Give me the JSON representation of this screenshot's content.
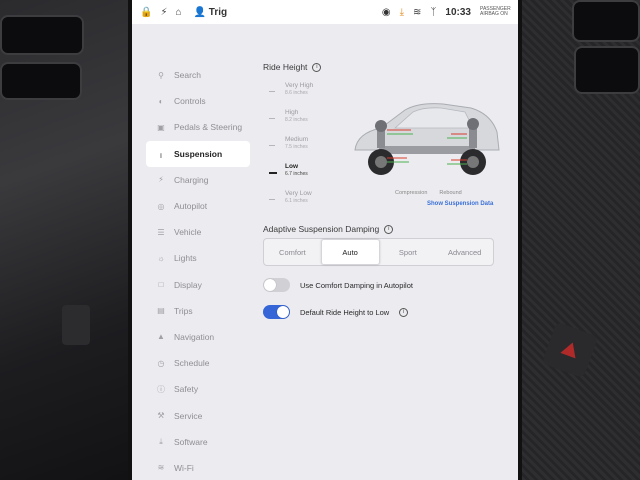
{
  "statusbar": {
    "user": "Trig",
    "time": "10:33",
    "airbag_label": "PASSENGER AIRBAG ON"
  },
  "sidebar": {
    "items": [
      {
        "label": "Search",
        "icon": "search-icon"
      },
      {
        "label": "Controls",
        "icon": "toggle-icon"
      },
      {
        "label": "Pedals & Steering",
        "icon": "car-icon"
      },
      {
        "label": "Suspension",
        "icon": "suspension-icon"
      },
      {
        "label": "Charging",
        "icon": "lightning-icon"
      },
      {
        "label": "Autopilot",
        "icon": "steering-wheel-icon"
      },
      {
        "label": "Vehicle",
        "icon": "sliders-icon"
      },
      {
        "label": "Lights",
        "icon": "bulb-icon"
      },
      {
        "label": "Display",
        "icon": "display-icon"
      },
      {
        "label": "Trips",
        "icon": "trips-icon"
      },
      {
        "label": "Navigation",
        "icon": "navigation-icon"
      },
      {
        "label": "Schedule",
        "icon": "clock-icon"
      },
      {
        "label": "Safety",
        "icon": "safety-icon"
      },
      {
        "label": "Service",
        "icon": "wrench-icon"
      },
      {
        "label": "Software",
        "icon": "download-icon"
      },
      {
        "label": "Wi-Fi",
        "icon": "wifi-icon"
      }
    ],
    "active_index": 3
  },
  "ride_height": {
    "title": "Ride Height",
    "levels": [
      {
        "name": "Very High",
        "value": "8.6 inches"
      },
      {
        "name": "High",
        "value": "8.2 inches"
      },
      {
        "name": "Medium",
        "value": "7.5 inches"
      },
      {
        "name": "Low",
        "value": "6.7 inches"
      },
      {
        "name": "Very Low",
        "value": "6.1 inches"
      }
    ],
    "selected": "Low",
    "legend_compression": "Compression",
    "legend_rebound": "Rebound",
    "show_data_link": "Show Suspension Data"
  },
  "damping": {
    "title": "Adaptive Suspension Damping",
    "options": [
      "Comfort",
      "Auto",
      "Sport",
      "Advanced"
    ],
    "selected": "Auto"
  },
  "toggles": {
    "comfort_autopilot": {
      "label": "Use Comfort Damping in Autopilot",
      "on": false
    },
    "default_low": {
      "label": "Default Ride Height to Low",
      "on": true
    }
  },
  "colors": {
    "accent": "#3565d6",
    "link": "#3a6fd8",
    "download": "#e08a1a"
  }
}
